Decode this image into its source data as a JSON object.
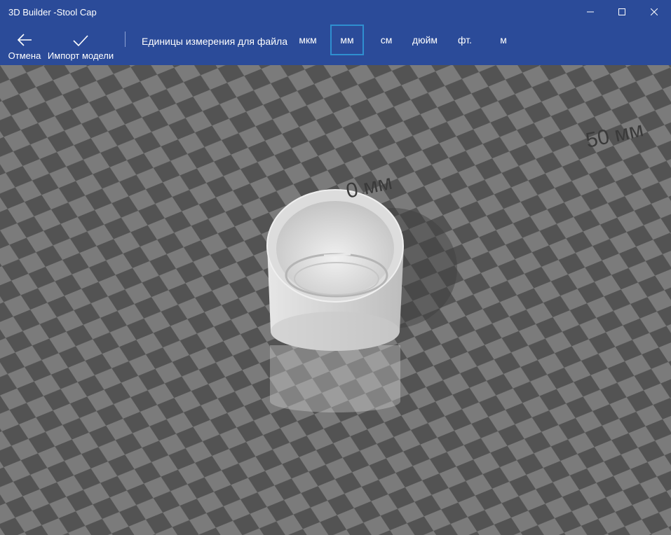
{
  "window": {
    "title": "3D Builder -Stool Cap",
    "controls": [
      "minimize-icon",
      "maximize-icon",
      "close-icon"
    ]
  },
  "toolbar": {
    "cancel_label": "Отмена",
    "cancel_icon": "back-arrow-icon",
    "import_label": "Импорт модели",
    "import_icon": "checkmark-icon",
    "units_label": "Единицы измерения для файла",
    "units": [
      {
        "label": "мкм",
        "selected": false
      },
      {
        "label": "мм",
        "selected": true
      },
      {
        "label": "см",
        "selected": false
      },
      {
        "label": "дюйм",
        "selected": false
      },
      {
        "label": "фт.",
        "selected": false
      },
      {
        "label": "м",
        "selected": false
      }
    ]
  },
  "viewport": {
    "scale_labels": [
      "0 мм",
      "50 мм"
    ],
    "model": "cylindrical cap"
  },
  "colors": {
    "accent": "#2b4b99",
    "selection": "#2f8fd0",
    "grid_dark": "#525252",
    "grid_light": "#7a7a7a"
  }
}
